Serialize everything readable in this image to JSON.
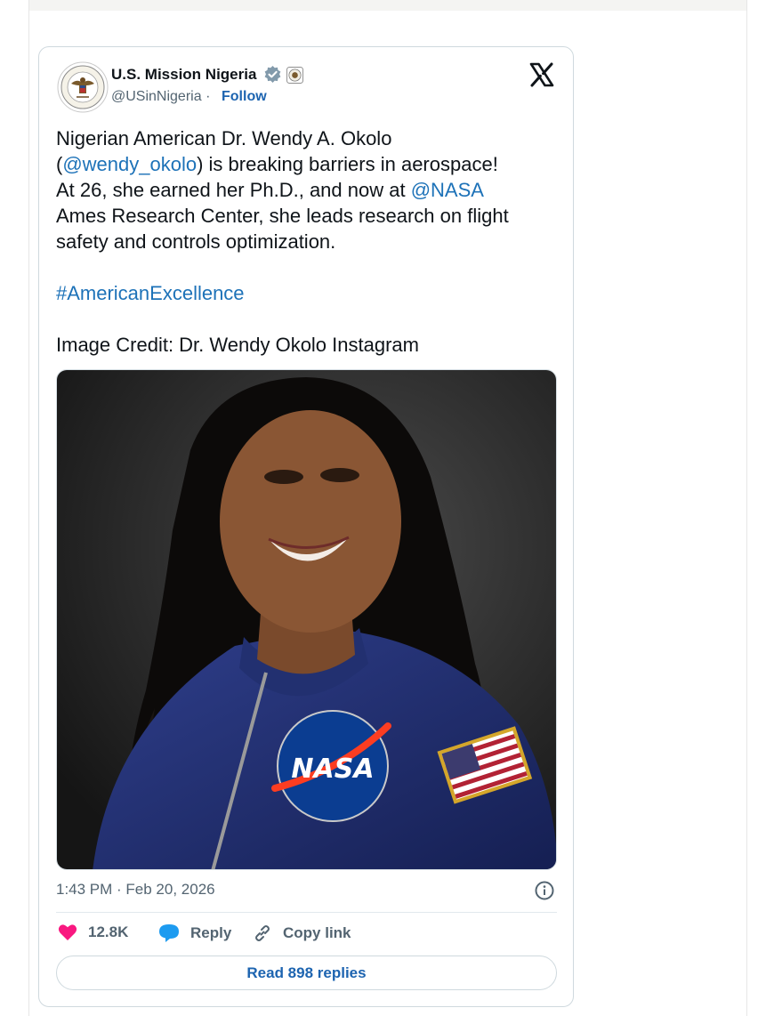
{
  "tweet": {
    "author_name": "U.S. Mission Nigeria",
    "handle": "@USinNigeria",
    "separator": "·",
    "follow_label": "Follow",
    "body": {
      "line1": "Nigerian American Dr. Wendy A. Okolo",
      "line2_prefix": "(",
      "mention_wendy": "@wendy_okolo",
      "line2_suffix": ") is breaking barriers in aerospace!",
      "line3_prefix": "At 26, she earned her Ph.D., and now at ",
      "mention_nasa": "@NASA",
      "line4": "Ames Research Center, she leads research on flight",
      "line5": "safety and controls optimization.",
      "hashtag": "#AmericanExcellence",
      "credit": "Image Credit: Dr. Wendy Okolo Instagram"
    },
    "photo_patch_text": "NASA",
    "timestamp": "1:43 PM · Feb 20, 2026",
    "likes": "12.8K",
    "reply_label": "Reply",
    "copy_link_label": "Copy link",
    "read_replies_label": "Read 898 replies"
  },
  "icons": [
    "verified-badge-icon",
    "government-seal-icon",
    "x-logo-icon",
    "info-icon",
    "heart-icon",
    "reply-bubble-icon",
    "link-icon"
  ],
  "colors": {
    "link_blue": "#1d72b8",
    "follow_blue": "#1d64b0",
    "heart_pink": "#f91880",
    "reply_blue": "#1d9bf0",
    "muted_text": "#536471",
    "border": "#cfd9de"
  }
}
